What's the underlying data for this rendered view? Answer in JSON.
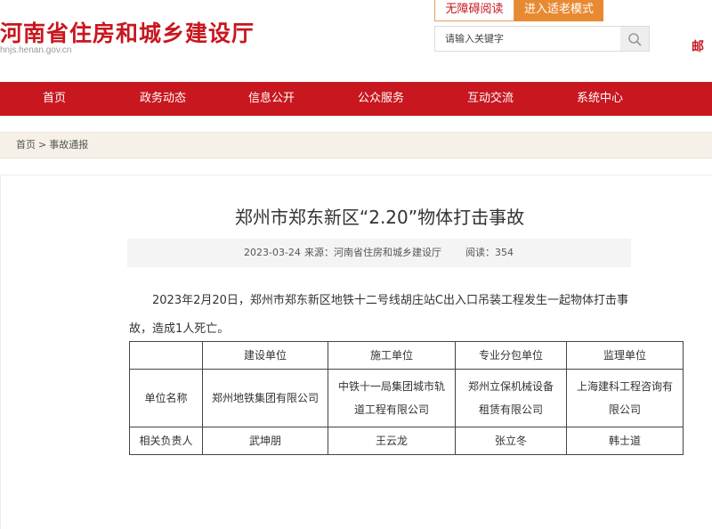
{
  "header": {
    "site_title": "河南省住房和城乡建设厅",
    "site_domain": "hnjs.henan.gov.cn",
    "accessibility_label": "无障碍阅读",
    "elder_mode_label": "进入适老模式",
    "search_placeholder": "请输入关键字",
    "corner_text": "邮"
  },
  "nav": {
    "items": [
      {
        "label": "首页"
      },
      {
        "label": "政务动态"
      },
      {
        "label": "信息公开"
      },
      {
        "label": "公众服务"
      },
      {
        "label": "互动交流"
      },
      {
        "label": "系统中心"
      }
    ]
  },
  "breadcrumb": {
    "home": "首页",
    "separator": ">",
    "current": "事故通报"
  },
  "article": {
    "title": "郑州市郑东新区“2.20”物体打击事故",
    "date": "2023-03-24",
    "source": "来源：河南省住房和城乡建设厅",
    "reads": "阅读：354",
    "para_line1": "2023年2月20日，郑州市郑东新区地铁十二号线胡庄站C出入口吊装工程发生一起物体打击事",
    "para_line2": "故，造成1人死亡。"
  },
  "table": {
    "header": [
      "",
      "建设单位",
      "施工单位",
      "专业分包单位",
      "监理单位"
    ],
    "rows": [
      {
        "label": "单位名称",
        "cells": [
          {
            "l1": "郑州地铁集团有限公司",
            "l2": ""
          },
          {
            "l1": "中铁十一局集团城市轨",
            "l2": "道工程有限公司"
          },
          {
            "l1": "郑州立保机械设备",
            "l2": "租赁有限公司"
          },
          {
            "l1": "上海建科工程咨询有",
            "l2": "限公司"
          }
        ]
      },
      {
        "label": "相关负责人",
        "cells": [
          {
            "l1": "武坤朋",
            "l2": ""
          },
          {
            "l1": "王云龙",
            "l2": ""
          },
          {
            "l1": "张立冬",
            "l2": ""
          },
          {
            "l1": "韩士道",
            "l2": ""
          }
        ]
      }
    ]
  }
}
